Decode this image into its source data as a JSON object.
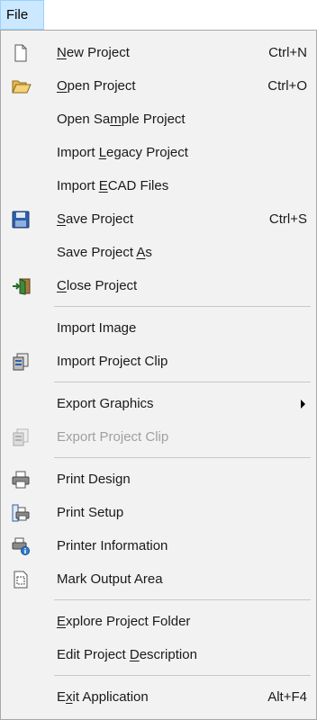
{
  "menubar": {
    "file_label": "File"
  },
  "menu": {
    "items": [
      {
        "label_pre": "",
        "label_u": "N",
        "label_post": "ew Project",
        "shortcut": "Ctrl+N",
        "icon": "new-document-icon"
      },
      {
        "label_pre": "",
        "label_u": "O",
        "label_post": "pen Project",
        "shortcut": "Ctrl+O",
        "icon": "open-folder-icon"
      },
      {
        "label_pre": "Open Sa",
        "label_u": "m",
        "label_post": "ple Project",
        "shortcut": "",
        "icon": ""
      },
      {
        "label_pre": "Import ",
        "label_u": "L",
        "label_post": "egacy Project",
        "shortcut": "",
        "icon": ""
      },
      {
        "label_pre": "Import ",
        "label_u": "E",
        "label_post": "CAD Files",
        "shortcut": "",
        "icon": ""
      },
      {
        "label_pre": "",
        "label_u": "S",
        "label_post": "ave Project",
        "shortcut": "Ctrl+S",
        "icon": "save-disk-icon"
      },
      {
        "label_pre": "Save Project ",
        "label_u": "A",
        "label_post": "s",
        "shortcut": "",
        "icon": ""
      },
      {
        "label_pre": "",
        "label_u": "C",
        "label_post": "lose Project",
        "shortcut": "",
        "icon": "exit-door-icon"
      },
      {
        "label_pre": "Import Image",
        "label_u": "",
        "label_post": "",
        "shortcut": "",
        "icon": ""
      },
      {
        "label_pre": "Import Project Clip",
        "label_u": "",
        "label_post": "",
        "shortcut": "",
        "icon": "import-clip-icon"
      },
      {
        "label_pre": "Export Graphics",
        "label_u": "",
        "label_post": "",
        "shortcut": "",
        "icon": ""
      },
      {
        "label_pre": "Export Project Clip",
        "label_u": "",
        "label_post": "",
        "shortcut": "",
        "icon": "export-clip-icon"
      },
      {
        "label_pre": "Print Design",
        "label_u": "",
        "label_post": "",
        "shortcut": "",
        "icon": "printer-icon"
      },
      {
        "label_pre": "Print Setup",
        "label_u": "",
        "label_post": "",
        "shortcut": "",
        "icon": "print-setup-icon"
      },
      {
        "label_pre": "Printer Information",
        "label_u": "",
        "label_post": "",
        "shortcut": "",
        "icon": "printer-info-icon"
      },
      {
        "label_pre": "Mark Output Area",
        "label_u": "",
        "label_post": "",
        "shortcut": "",
        "icon": "output-area-icon"
      },
      {
        "label_pre": "",
        "label_u": "E",
        "label_post": "xplore Project Folder",
        "shortcut": "",
        "icon": ""
      },
      {
        "label_pre": "Edit Project ",
        "label_u": "D",
        "label_post": "escription",
        "shortcut": "",
        "icon": ""
      },
      {
        "label_pre": "E",
        "label_u": "x",
        "label_post": "it Application",
        "shortcut": "Alt+F4",
        "icon": ""
      }
    ]
  }
}
